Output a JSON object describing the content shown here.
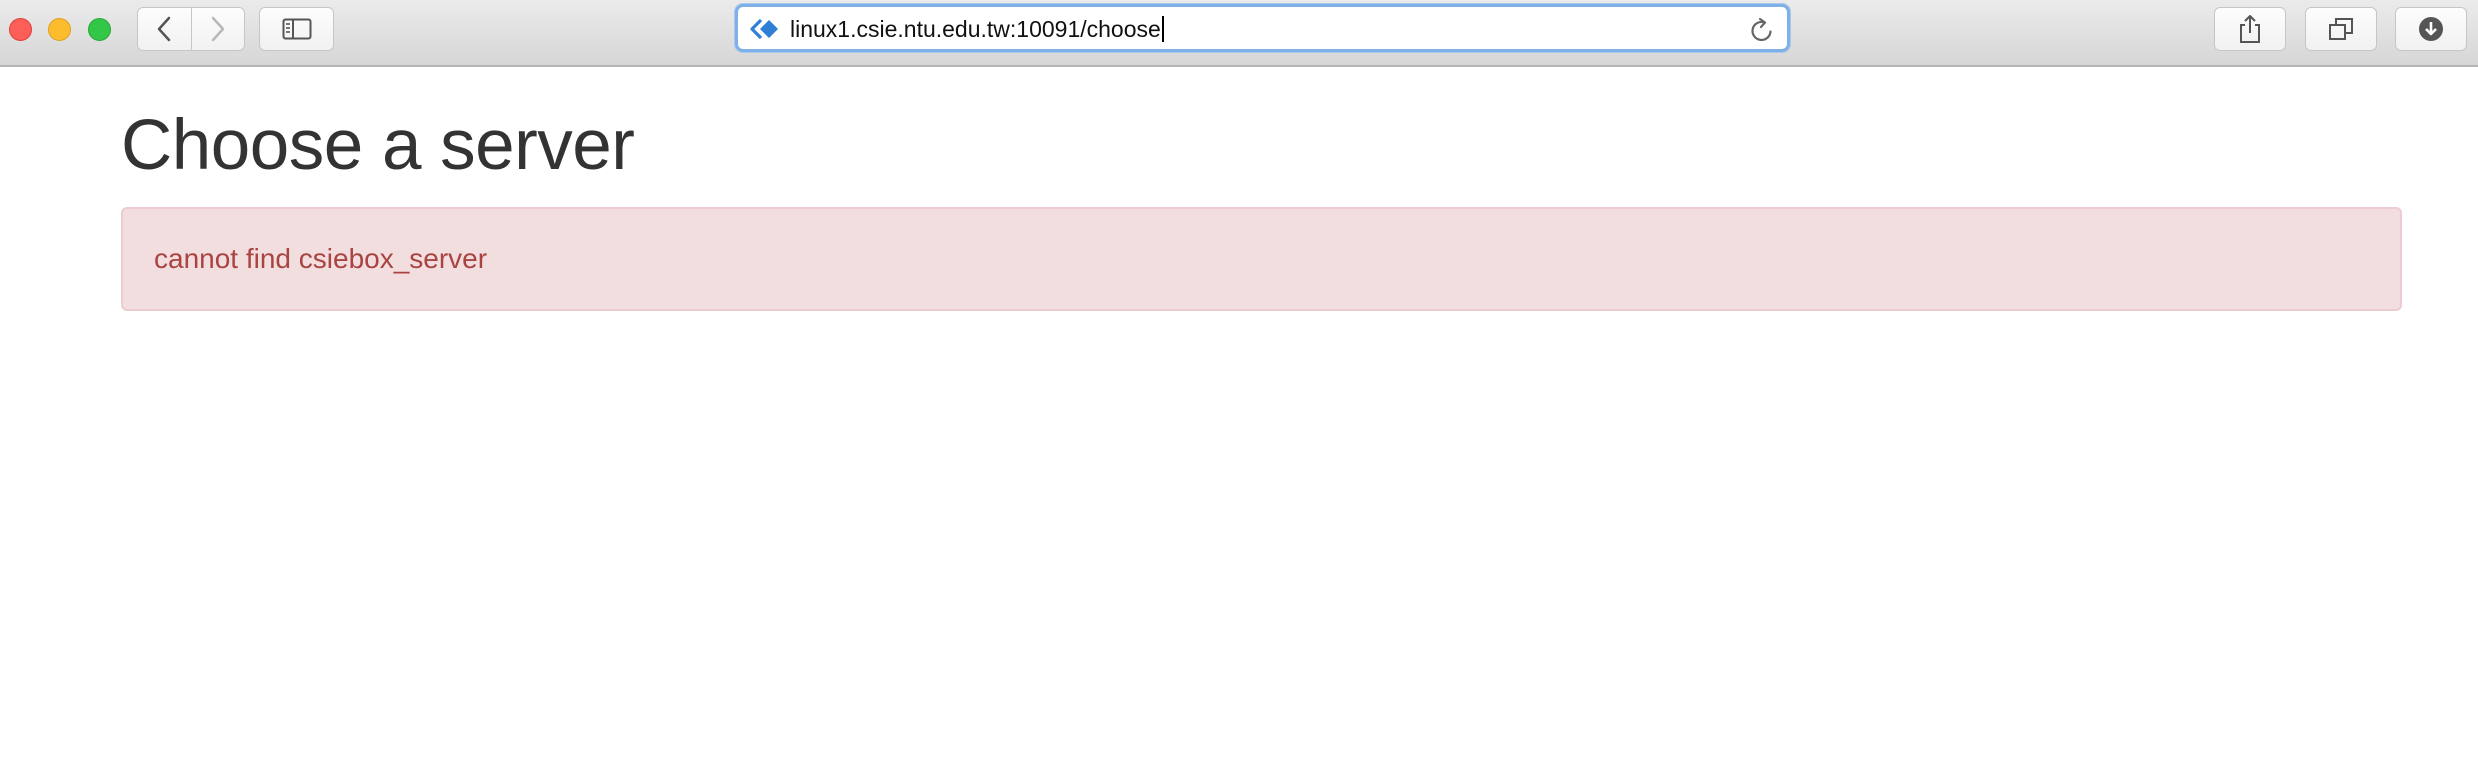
{
  "browser": {
    "url": "linux1.csie.ntu.edu.tw:10091/choose",
    "icons": {
      "close": "close-button",
      "minimize": "minimize-button",
      "maximize": "maximize-button",
      "back": "chevron-left-icon",
      "forward": "chevron-right-icon",
      "sidebar": "sidebar-icon",
      "site": "site-icon",
      "reload": "reload-icon",
      "share": "share-icon",
      "tabs": "tabs-overview-icon",
      "downloads": "download-icon"
    },
    "accent_color": "#7fb0e6"
  },
  "page": {
    "title": "Choose a server",
    "alert": {
      "message": "cannot find csiebox_server",
      "background": "#f2dede",
      "text_color": "#a94442"
    }
  }
}
